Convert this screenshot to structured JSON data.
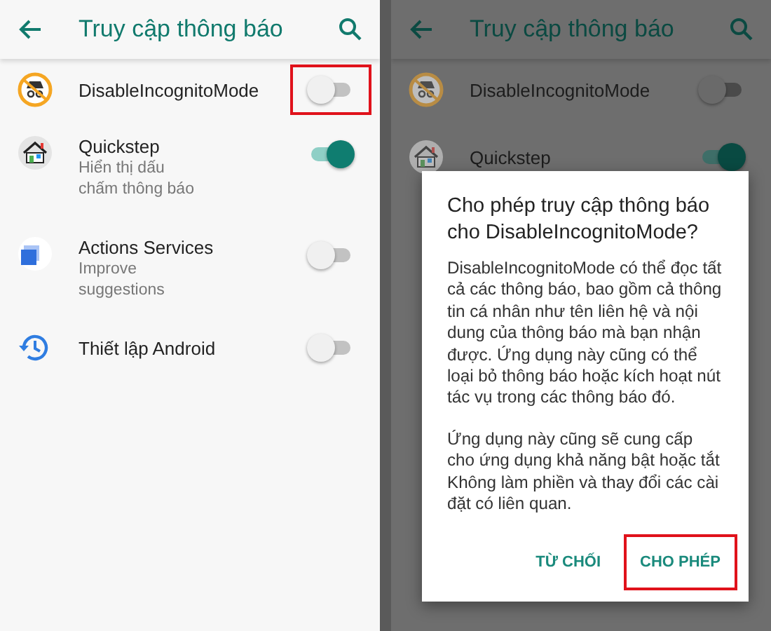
{
  "left_screen": {
    "app_bar": {
      "title": "Truy cập thông báo"
    },
    "apps": [
      {
        "name": "DisableIncognitoMode",
        "on": false,
        "highlighted": true
      },
      {
        "name": "Quickstep",
        "subtitle": "Hiển thị dấu chấm thông báo",
        "on": true,
        "highlighted": false
      },
      {
        "name": "Actions Services",
        "subtitle": "Improve suggestions",
        "on": false,
        "highlighted": false
      },
      {
        "name": "Thiết lập Android",
        "on": false,
        "highlighted": false
      }
    ]
  },
  "right_screen": {
    "app_bar": {
      "title": "Truy cập thông báo"
    },
    "apps": [
      {
        "name": "DisableIncognitoMode",
        "on": false
      },
      {
        "name": "Quickstep",
        "on": true
      }
    ],
    "dialog": {
      "title": "Cho phép truy cập thông báo cho DisableIncognitoMode?",
      "paragraphs": [
        "DisableIncognitoMode có thể đọc tất cả các thông báo, bao gồm cả thông tin cá nhân như tên liên hệ và nội dung của thông báo mà bạn nhận được. Ứng dụng này cũng có thể loại bỏ thông báo hoặc kích hoạt nút tác vụ trong các thông báo đó.",
        "Ứng dụng này cũng sẽ cung cấp cho ứng dụng khả năng bật hoặc tắt Không làm phiền và thay đổi các cài đặt có liên quan."
      ],
      "buttons": [
        {
          "label": "TỪ CHỐI",
          "highlighted": false
        },
        {
          "label": "CHO PHÉP",
          "highlighted": true
        }
      ]
    }
  }
}
